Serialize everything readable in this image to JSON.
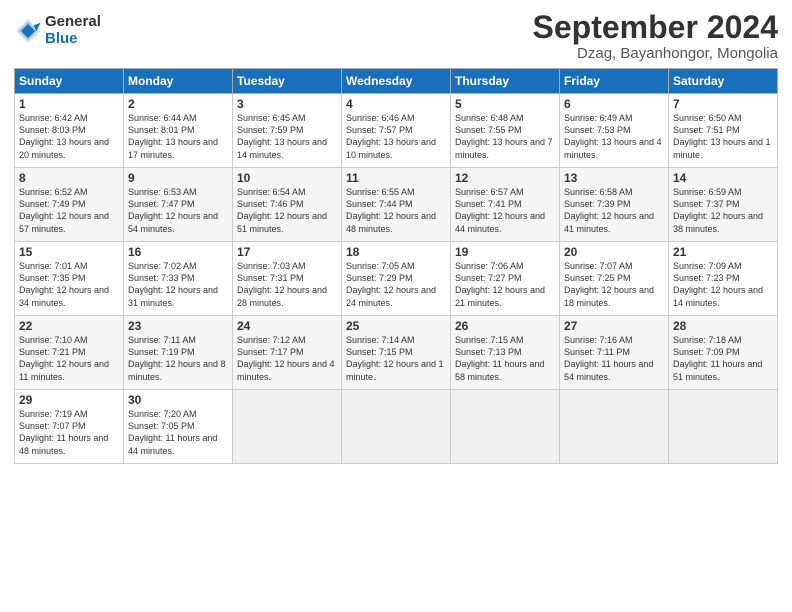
{
  "logo": {
    "general": "General",
    "blue": "Blue"
  },
  "title": "September 2024",
  "location": "Dzag, Bayanhongor, Mongolia",
  "days_header": [
    "Sunday",
    "Monday",
    "Tuesday",
    "Wednesday",
    "Thursday",
    "Friday",
    "Saturday"
  ],
  "weeks": [
    [
      {
        "day": "1",
        "rise": "6:42 AM",
        "set": "8:03 PM",
        "daylight": "13 hours and 20 minutes."
      },
      {
        "day": "2",
        "rise": "6:44 AM",
        "set": "8:01 PM",
        "daylight": "13 hours and 17 minutes."
      },
      {
        "day": "3",
        "rise": "6:45 AM",
        "set": "7:59 PM",
        "daylight": "13 hours and 14 minutes."
      },
      {
        "day": "4",
        "rise": "6:46 AM",
        "set": "7:57 PM",
        "daylight": "13 hours and 10 minutes."
      },
      {
        "day": "5",
        "rise": "6:48 AM",
        "set": "7:55 PM",
        "daylight": "13 hours and 7 minutes."
      },
      {
        "day": "6",
        "rise": "6:49 AM",
        "set": "7:53 PM",
        "daylight": "13 hours and 4 minutes."
      },
      {
        "day": "7",
        "rise": "6:50 AM",
        "set": "7:51 PM",
        "daylight": "13 hours and 1 minute."
      }
    ],
    [
      {
        "day": "8",
        "rise": "6:52 AM",
        "set": "7:49 PM",
        "daylight": "12 hours and 57 minutes."
      },
      {
        "day": "9",
        "rise": "6:53 AM",
        "set": "7:47 PM",
        "daylight": "12 hours and 54 minutes."
      },
      {
        "day": "10",
        "rise": "6:54 AM",
        "set": "7:46 PM",
        "daylight": "12 hours and 51 minutes."
      },
      {
        "day": "11",
        "rise": "6:55 AM",
        "set": "7:44 PM",
        "daylight": "12 hours and 48 minutes."
      },
      {
        "day": "12",
        "rise": "6:57 AM",
        "set": "7:41 PM",
        "daylight": "12 hours and 44 minutes."
      },
      {
        "day": "13",
        "rise": "6:58 AM",
        "set": "7:39 PM",
        "daylight": "12 hours and 41 minutes."
      },
      {
        "day": "14",
        "rise": "6:59 AM",
        "set": "7:37 PM",
        "daylight": "12 hours and 38 minutes."
      }
    ],
    [
      {
        "day": "15",
        "rise": "7:01 AM",
        "set": "7:35 PM",
        "daylight": "12 hours and 34 minutes."
      },
      {
        "day": "16",
        "rise": "7:02 AM",
        "set": "7:33 PM",
        "daylight": "12 hours and 31 minutes."
      },
      {
        "day": "17",
        "rise": "7:03 AM",
        "set": "7:31 PM",
        "daylight": "12 hours and 28 minutes."
      },
      {
        "day": "18",
        "rise": "7:05 AM",
        "set": "7:29 PM",
        "daylight": "12 hours and 24 minutes."
      },
      {
        "day": "19",
        "rise": "7:06 AM",
        "set": "7:27 PM",
        "daylight": "12 hours and 21 minutes."
      },
      {
        "day": "20",
        "rise": "7:07 AM",
        "set": "7:25 PM",
        "daylight": "12 hours and 18 minutes."
      },
      {
        "day": "21",
        "rise": "7:09 AM",
        "set": "7:23 PM",
        "daylight": "12 hours and 14 minutes."
      }
    ],
    [
      {
        "day": "22",
        "rise": "7:10 AM",
        "set": "7:21 PM",
        "daylight": "12 hours and 11 minutes."
      },
      {
        "day": "23",
        "rise": "7:11 AM",
        "set": "7:19 PM",
        "daylight": "12 hours and 8 minutes."
      },
      {
        "day": "24",
        "rise": "7:12 AM",
        "set": "7:17 PM",
        "daylight": "12 hours and 4 minutes."
      },
      {
        "day": "25",
        "rise": "7:14 AM",
        "set": "7:15 PM",
        "daylight": "12 hours and 1 minute."
      },
      {
        "day": "26",
        "rise": "7:15 AM",
        "set": "7:13 PM",
        "daylight": "11 hours and 58 minutes."
      },
      {
        "day": "27",
        "rise": "7:16 AM",
        "set": "7:11 PM",
        "daylight": "11 hours and 54 minutes."
      },
      {
        "day": "28",
        "rise": "7:18 AM",
        "set": "7:09 PM",
        "daylight": "11 hours and 51 minutes."
      }
    ],
    [
      {
        "day": "29",
        "rise": "7:19 AM",
        "set": "7:07 PM",
        "daylight": "11 hours and 48 minutes."
      },
      {
        "day": "30",
        "rise": "7:20 AM",
        "set": "7:05 PM",
        "daylight": "11 hours and 44 minutes."
      },
      null,
      null,
      null,
      null,
      null
    ]
  ]
}
